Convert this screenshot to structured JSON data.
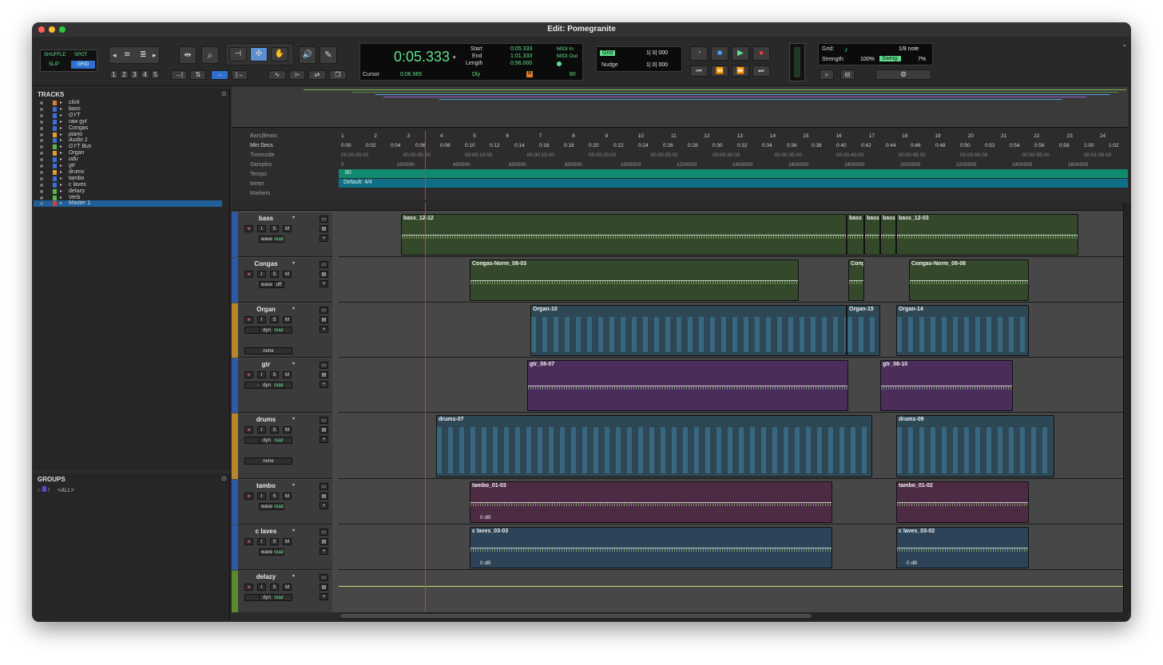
{
  "window": {
    "title": "Edit: Pomegranite"
  },
  "edit_modes": [
    "SHUFFLE",
    "SPOT",
    "SLIP",
    "GRID"
  ],
  "zoom_presets": [
    "1",
    "2",
    "3",
    "4",
    "5"
  ],
  "counter": {
    "main": "0:05.333",
    "start_label": "Start",
    "start": "0:05.333",
    "end_label": "End",
    "end": "1:01.333",
    "length_label": "Length",
    "length": "0:56.000",
    "cursor_label": "Cursor",
    "cursor": "0:06.965",
    "midi_in": "MIDI In",
    "midi_out": "MIDI Out",
    "tempo": "80",
    "dly": "Dly"
  },
  "grid": {
    "label": "Grid",
    "value": "1| 0| 000"
  },
  "nudge": {
    "label": "Nudge",
    "value": "1| 0| 000"
  },
  "grid_panel": {
    "grid_label": "Grid:",
    "grid_value": "1/8 note",
    "strength_label": "Strength:",
    "strength": "100%",
    "swing_label": "Swing:",
    "swing": "7%"
  },
  "tracks_panel": {
    "title": "TRACKS",
    "items": [
      {
        "name": "click",
        "italic": true,
        "color": "#e07a2a"
      },
      {
        "name": "bass",
        "italic": false,
        "color": "#3a6fd8"
      },
      {
        "name": "GYT",
        "italic": true,
        "color": "#3a6fd8"
      },
      {
        "name": "raw gyt",
        "italic": true,
        "color": "#3a6fd8"
      },
      {
        "name": "Congas",
        "italic": false,
        "color": "#3a6fd8"
      },
      {
        "name": "piano",
        "italic": true,
        "color": "#e0a02a"
      },
      {
        "name": "Audio 1",
        "italic": true,
        "color": "#3a6fd8"
      },
      {
        "name": "GYT Bus",
        "italic": true,
        "color": "#5ab84a"
      },
      {
        "name": "Organ",
        "italic": false,
        "color": "#e0a02a"
      },
      {
        "name": "udu",
        "italic": true,
        "color": "#3a6fd8"
      },
      {
        "name": "gtr",
        "italic": true,
        "color": "#3a6fd8"
      },
      {
        "name": "drums",
        "italic": false,
        "color": "#e0a02a"
      },
      {
        "name": "tambo",
        "italic": false,
        "color": "#3a6fd8"
      },
      {
        "name": "c laves",
        "italic": false,
        "color": "#3a6fd8"
      },
      {
        "name": "delazy",
        "italic": false,
        "color": "#5ab84a"
      },
      {
        "name": "Verb",
        "italic": false,
        "color": "#5ab84a"
      },
      {
        "name": "Master 1",
        "italic": false,
        "color": "#d83a3a",
        "selected": true
      }
    ]
  },
  "groups_panel": {
    "title": "GROUPS",
    "items": [
      {
        "id": "!",
        "name": "<ALL>"
      }
    ]
  },
  "rulers": {
    "labels": [
      "Bars|Beats",
      "Min:Secs",
      "Timecode",
      "Samples",
      "Tempo",
      "Meter",
      "Markers"
    ],
    "bars": [
      "1",
      "2",
      "3",
      "4",
      "5",
      "6",
      "7",
      "8",
      "9",
      "10",
      "11",
      "12",
      "13",
      "14",
      "15",
      "16",
      "17",
      "18",
      "19",
      "20",
      "21",
      "22",
      "23",
      "24"
    ],
    "minsecs": [
      "0:00",
      "0:02",
      "0:04",
      "0:06",
      "0:08",
      "0:10",
      "0:12",
      "0:14",
      "0:16",
      "0:18",
      "0:20",
      "0:22",
      "0:24",
      "0:26",
      "0:28",
      "0:30",
      "0:32",
      "0:34",
      "0:36",
      "0:38",
      "0:40",
      "0:42",
      "0:44",
      "0:46",
      "0:48",
      "0:50",
      "0:52",
      "0:54",
      "0:56",
      "0:58",
      "1:00",
      "1:02"
    ],
    "timecode": [
      "00:00:00:00",
      "00:00:05:00",
      "00:00:10:00",
      "00:00:15:00",
      "00:00:20:00",
      "00:00:25:00",
      "00:00:30:00",
      "00:00:35:00",
      "00:00:40:00",
      "00:00:45:00",
      "00:00:50:00",
      "00:00:55:00",
      "00:01:00:00"
    ],
    "samples": [
      "0",
      "200000",
      "400000",
      "600000",
      "800000",
      "1000000",
      "1200000",
      "1400000",
      "1600000",
      "1800000",
      "2000000",
      "2200000",
      "2400000",
      "2600000"
    ],
    "tempo_value": "80",
    "meter_value": "Default: 4/4"
  },
  "tracks": [
    {
      "name": "bass",
      "btns": [
        "wave",
        "read"
      ],
      "clips": [
        [
          "bass_12-12",
          78,
          636
        ],
        [
          "bass",
          636,
          658
        ],
        [
          "bass",
          658,
          678
        ],
        [
          "bass",
          678,
          698
        ],
        [
          "bass_12-03",
          698,
          926
        ]
      ],
      "color": "#34492b",
      "type": "audio"
    },
    {
      "name": "Congas",
      "btns": [
        "wave",
        "off"
      ],
      "clips": [
        [
          "Congas-Norm_08-03",
          164,
          576
        ],
        [
          "Cong",
          638,
          658
        ],
        [
          "Congas-Norm_08-08",
          714,
          864
        ]
      ],
      "color": "#34492b",
      "type": "audio"
    },
    {
      "name": "Organ",
      "btns": [
        "clips",
        "dyn",
        "read",
        "none"
      ],
      "clips": [
        [
          "Organ-10",
          240,
          636
        ],
        [
          "Organ-15",
          636,
          678
        ],
        [
          "Organ-14",
          698,
          864
        ]
      ],
      "color": "#2d4755",
      "type": "midi"
    },
    {
      "name": "gtr",
      "btns": [
        "waveform",
        "dyn",
        "read"
      ],
      "clips": [
        [
          "gtr_08-07",
          236,
          638
        ],
        [
          "gtr_08-10",
          678,
          844
        ]
      ],
      "color": "#4b2d5c",
      "type": "audio"
    },
    {
      "name": "drums",
      "btns": [
        "clips",
        "dyn",
        "read",
        "none"
      ],
      "clips": [
        [
          "drums-07",
          122,
          668
        ],
        [
          "drums-09",
          698,
          896
        ]
      ],
      "color": "#2d4755",
      "type": "midi"
    },
    {
      "name": "tambo",
      "btns": [
        "wave",
        "read"
      ],
      "clips": [
        [
          "tambo_01-03",
          164,
          618,
          "0 dB"
        ],
        [
          "tambo_01-02",
          698,
          864
        ]
      ],
      "color": "#4e2b44",
      "type": "audio"
    },
    {
      "name": "c laves",
      "btns": [
        "wave",
        "read"
      ],
      "clips": [
        [
          "c laves_03-03",
          164,
          618,
          "0 dB"
        ],
        [
          "c laves_03-02",
          698,
          864,
          "0 dB"
        ]
      ],
      "color": "#2d4357",
      "type": "audio"
    },
    {
      "name": "delazy",
      "btns": [
        "volume",
        "dyn",
        "read"
      ],
      "clips": [],
      "color": "#474747",
      "type": "aux"
    }
  ],
  "track_buttons": {
    "input": "I",
    "solo": "S",
    "mute": "M"
  }
}
